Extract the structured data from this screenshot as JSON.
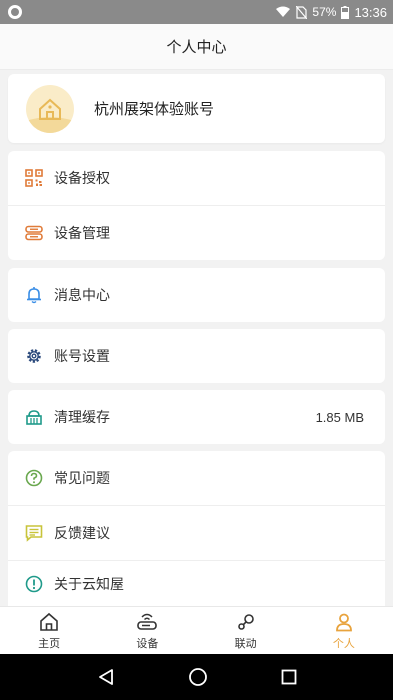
{
  "status_bar": {
    "battery": "57%",
    "time": "13:36"
  },
  "header": {
    "title": "个人中心"
  },
  "profile": {
    "account_name": "杭州展架体验账号"
  },
  "menu": {
    "device_auth": "设备授权",
    "device_manage": "设备管理",
    "messages": "消息中心",
    "account_settings": "账号设置",
    "clear_cache": "清理缓存",
    "cache_size": "1.85 MB",
    "faq": "常见问题",
    "feedback": "反馈建议",
    "about": "关于云知屋"
  },
  "tabs": [
    {
      "label": "主页"
    },
    {
      "label": "设备"
    },
    {
      "label": "联动"
    },
    {
      "label": "个人"
    }
  ],
  "colors": {
    "accent": "#e8a33d",
    "orange_icon": "#e07b39",
    "blue_icon": "#3a8ee6",
    "navy_icon": "#2c4a7c",
    "teal_icon": "#1f9a8a",
    "green_icon": "#6aa84f",
    "yellow_green_icon": "#c8c43a"
  }
}
